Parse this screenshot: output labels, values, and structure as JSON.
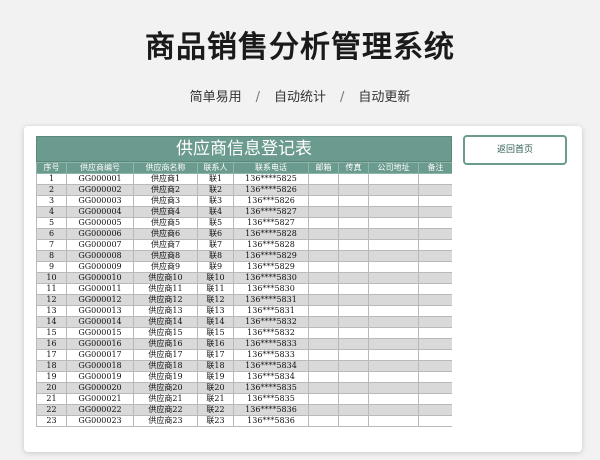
{
  "header": {
    "title": "商品销售分析管理系统",
    "features": [
      "简单易用",
      "自动统计",
      "自动更新"
    ],
    "separator": "/"
  },
  "sheet": {
    "title": "供应商信息登记表",
    "columns": [
      "序号",
      "供应商编号",
      "供应商名称",
      "联系人",
      "联系电话",
      "邮箱",
      "传真",
      "公司地址",
      "备注"
    ],
    "rows": [
      [
        "1",
        "GG000001",
        "供应商1",
        "联1",
        "136****5825",
        "",
        "",
        "",
        ""
      ],
      [
        "2",
        "GG000002",
        "供应商2",
        "联2",
        "136****5826",
        "",
        "",
        "",
        ""
      ],
      [
        "3",
        "GG000003",
        "供应商3",
        "联3",
        "136***5826",
        "",
        "",
        "",
        ""
      ],
      [
        "4",
        "GG000004",
        "供应商4",
        "联4",
        "136****5827",
        "",
        "",
        "",
        ""
      ],
      [
        "5",
        "GG000005",
        "供应商5",
        "联5",
        "136***5827",
        "",
        "",
        "",
        ""
      ],
      [
        "6",
        "GG000006",
        "供应商6",
        "联6",
        "136****5828",
        "",
        "",
        "",
        ""
      ],
      [
        "7",
        "GG000007",
        "供应商7",
        "联7",
        "136***5828",
        "",
        "",
        "",
        ""
      ],
      [
        "8",
        "GG000008",
        "供应商8",
        "联8",
        "136****5829",
        "",
        "",
        "",
        ""
      ],
      [
        "9",
        "GG000009",
        "供应商9",
        "联9",
        "136***5829",
        "",
        "",
        "",
        ""
      ],
      [
        "10",
        "GG000010",
        "供应商10",
        "联10",
        "136****5830",
        "",
        "",
        "",
        ""
      ],
      [
        "11",
        "GG000011",
        "供应商11",
        "联11",
        "136***5830",
        "",
        "",
        "",
        ""
      ],
      [
        "12",
        "GG000012",
        "供应商12",
        "联12",
        "136****5831",
        "",
        "",
        "",
        ""
      ],
      [
        "13",
        "GG000013",
        "供应商13",
        "联13",
        "136***5831",
        "",
        "",
        "",
        ""
      ],
      [
        "14",
        "GG000014",
        "供应商14",
        "联14",
        "136****5832",
        "",
        "",
        "",
        ""
      ],
      [
        "15",
        "GG000015",
        "供应商15",
        "联15",
        "136***5832",
        "",
        "",
        "",
        ""
      ],
      [
        "16",
        "GG000016",
        "供应商16",
        "联16",
        "136****5833",
        "",
        "",
        "",
        ""
      ],
      [
        "17",
        "GG000017",
        "供应商17",
        "联17",
        "136***5833",
        "",
        "",
        "",
        ""
      ],
      [
        "18",
        "GG000018",
        "供应商18",
        "联18",
        "136****5834",
        "",
        "",
        "",
        ""
      ],
      [
        "19",
        "GG000019",
        "供应商19",
        "联19",
        "136***5834",
        "",
        "",
        "",
        ""
      ],
      [
        "20",
        "GG000020",
        "供应商20",
        "联20",
        "136****5835",
        "",
        "",
        "",
        ""
      ],
      [
        "21",
        "GG000021",
        "供应商21",
        "联21",
        "136***5835",
        "",
        "",
        "",
        ""
      ],
      [
        "22",
        "GG000022",
        "供应商22",
        "联22",
        "136****5836",
        "",
        "",
        "",
        ""
      ],
      [
        "23",
        "GG000023",
        "供应商23",
        "联23",
        "136***5836",
        "",
        "",
        "",
        ""
      ]
    ]
  },
  "back_button": {
    "label": "返回首页"
  }
}
